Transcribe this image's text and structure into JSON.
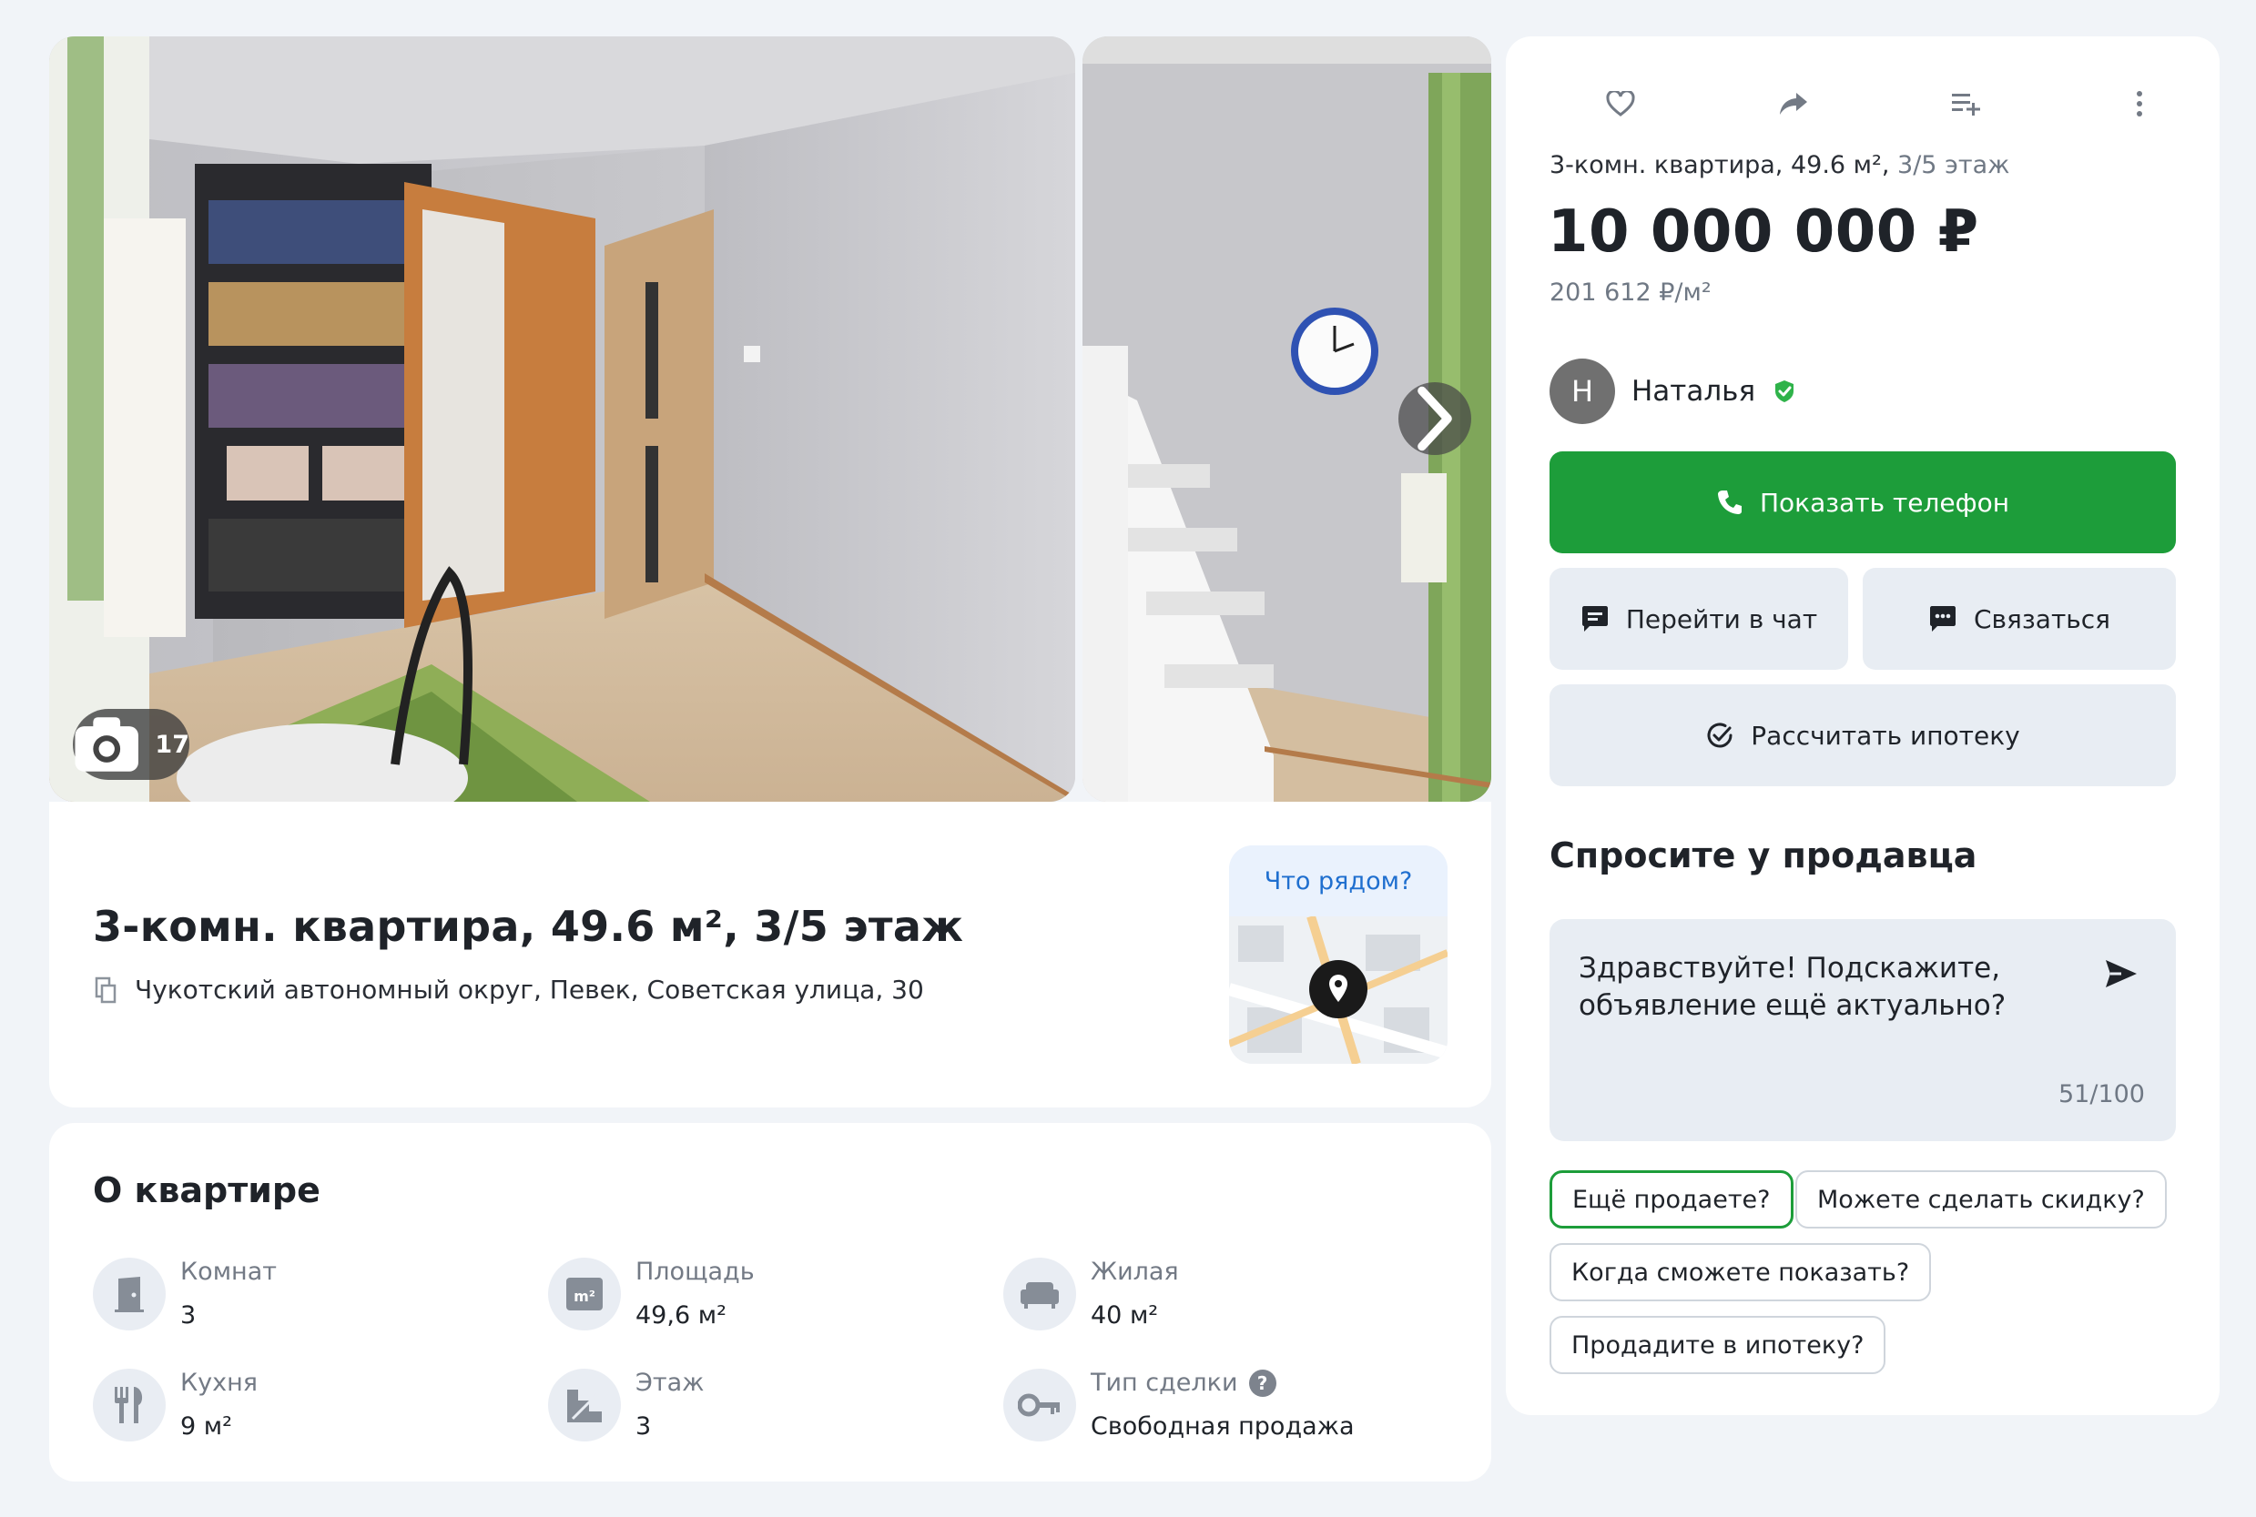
{
  "gallery": {
    "photo_count": "17"
  },
  "listing": {
    "title": "3-комн. квартира, 49.6 м², 3/5 этаж",
    "address": "Чукотский автономный округ, Певек, Советская улица, 30",
    "map_label": "Что рядом?"
  },
  "about": {
    "title": "О квартире",
    "features": [
      {
        "label": "Комнат",
        "value": "3",
        "icon": "door-icon"
      },
      {
        "label": "Площадь",
        "value": "49,6 м²",
        "icon": "area-m2-icon"
      },
      {
        "label": "Жилая",
        "value": "40 м²",
        "icon": "sofa-icon"
      },
      {
        "label": "Кухня",
        "value": "9 м²",
        "icon": "fork-knife-icon"
      },
      {
        "label": "Этаж",
        "value": "3",
        "icon": "stairs-icon"
      },
      {
        "label": "Тип сделки",
        "value": "Свободная продажа",
        "icon": "key-icon",
        "help": "?"
      }
    ]
  },
  "panel": {
    "summary": "3-комн. квартира, 49.6 м², ",
    "summary_floor": "3/5 этаж",
    "price": "10 000 000 ₽",
    "price_per_m2": "201 612 ₽/м²",
    "seller": {
      "initial": "Н",
      "name": "Наталья"
    },
    "buttons": {
      "show_phone": "Показать телефон",
      "chat": "Перейти в чат",
      "contact": "Связаться",
      "mortgage": "Рассчитать ипотеку"
    },
    "ask_title": "Спросите у продавца",
    "message": "Здравствуйте! Подскажите, объявление ещё актуально?",
    "message_counter": "51/100",
    "chips": [
      "Ещё продаете?",
      "Можете сделать скидку?",
      "Когда сможете показать?",
      "Продадите в ипотеку?"
    ]
  },
  "colors": {
    "accent_green": "#1d9d3a",
    "link_blue": "#1f6fcf",
    "page_bg": "#f1f4f8"
  }
}
